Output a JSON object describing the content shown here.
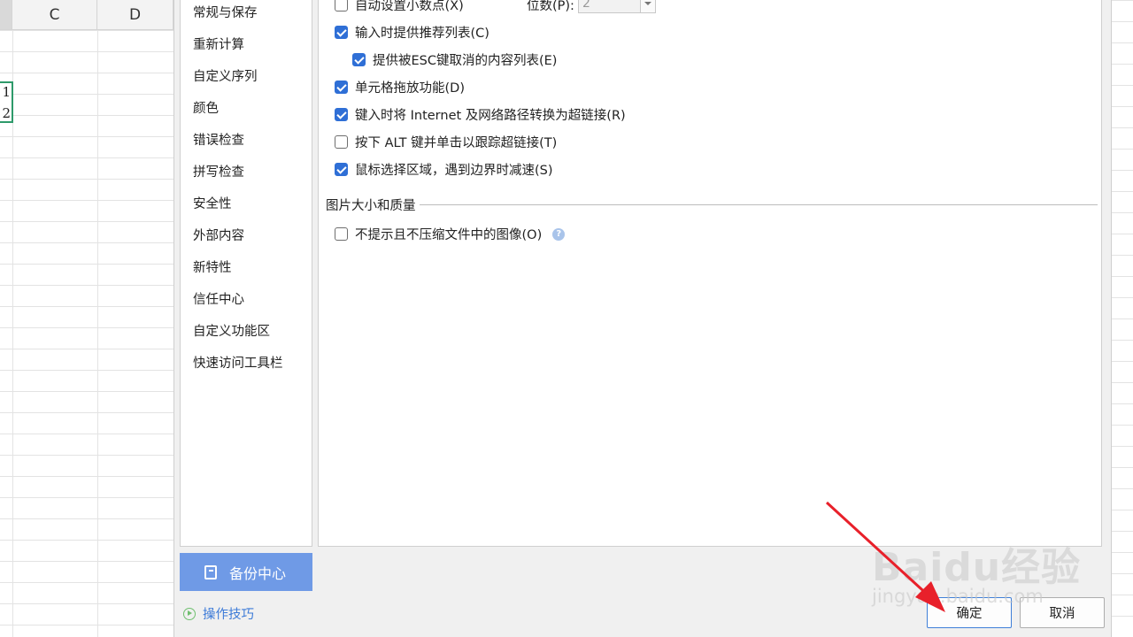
{
  "sheet": {
    "columns": [
      "C",
      "D"
    ],
    "cells": [
      "1",
      "2"
    ]
  },
  "dialog": {
    "sidebar": {
      "items": [
        "常规与保存",
        "重新计算",
        "自定义序列",
        "颜色",
        "错误检查",
        "拼写检查",
        "安全性",
        "外部内容",
        "新特性",
        "信任中心",
        "自定义功能区",
        "快速访问工具栏"
      ],
      "backup_label": "备份中心",
      "tips_label": "操作技巧"
    },
    "options": {
      "auto_decimal": {
        "label": "自动设置小数点(X)",
        "checked": false
      },
      "digits_label": "位数(P):",
      "digits_value": "2",
      "autocomplete": {
        "label": "输入时提供推荐列表(C)",
        "checked": true
      },
      "esc_list": {
        "label": "提供被ESC键取消的内容列表(E)",
        "checked": true
      },
      "drag_drop": {
        "label": "单元格拖放功能(D)",
        "checked": true
      },
      "hyperlink": {
        "label": "键入时将 Internet 及网络路径转换为超链接(R)",
        "checked": true
      },
      "alt_click": {
        "label": "按下 ALT 键并单击以跟踪超链接(T)",
        "checked": false
      },
      "slow_edge": {
        "label": "鼠标选择区域，遇到边界时减速(S)",
        "checked": true
      }
    },
    "image_section": {
      "title": "图片大小和质量",
      "no_compress": {
        "label": "不提示且不压缩文件中的图像(O)",
        "checked": false
      }
    },
    "buttons": {
      "ok": "确定",
      "cancel": "取消"
    }
  },
  "watermark": {
    "text": "Baidu经验",
    "sub": "jingyan.baidu.com"
  },
  "colors": {
    "accent": "#2f6fd6",
    "backup_bg": "#6f9ae6",
    "arrow": "#e8202a"
  }
}
